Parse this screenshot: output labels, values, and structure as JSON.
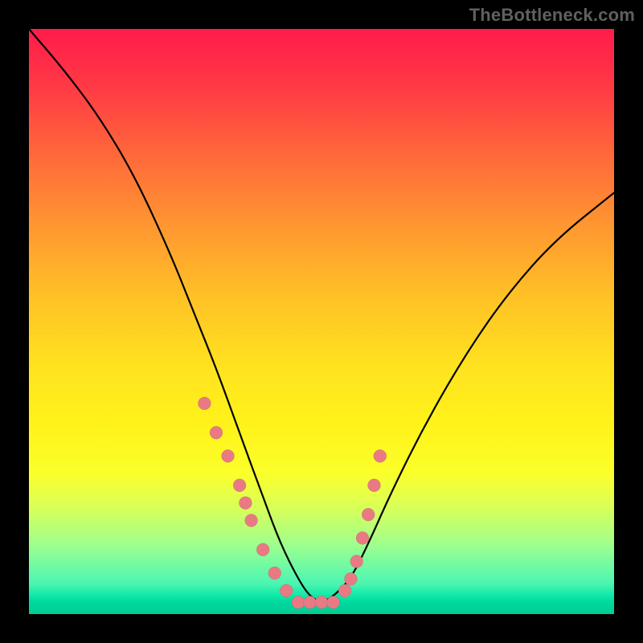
{
  "watermark": "TheBottleneck.com",
  "chart_data": {
    "type": "line",
    "title": "",
    "xlabel": "",
    "ylabel": "",
    "xlim": [
      0,
      100
    ],
    "ylim": [
      0,
      100
    ],
    "grid": false,
    "legend": false,
    "series": [
      {
        "name": "bottleneck-curve",
        "x": [
          0,
          6,
          12,
          18,
          24,
          28,
          32,
          36,
          40,
          43,
          46,
          48,
          50,
          52,
          55,
          58,
          62,
          68,
          75,
          82,
          90,
          100
        ],
        "y": [
          100,
          93,
          85,
          75,
          62,
          52,
          42,
          31,
          20,
          12,
          6,
          3,
          2,
          3,
          6,
          12,
          21,
          33,
          45,
          55,
          64,
          72
        ]
      }
    ],
    "markers": {
      "name": "bottleneck-data-points",
      "x": [
        30,
        32,
        34,
        36,
        37,
        38,
        40,
        42,
        44,
        46,
        48,
        50,
        52,
        54,
        55,
        56,
        57,
        58,
        59,
        60
      ],
      "y": [
        36,
        31,
        27,
        22,
        19,
        16,
        11,
        7,
        4,
        2,
        2,
        2,
        2,
        4,
        6,
        9,
        13,
        17,
        22,
        27
      ]
    },
    "gradient_stops": [
      {
        "pos": 0,
        "color": "#ff1b4a"
      },
      {
        "pos": 50,
        "color": "#ffe31f"
      },
      {
        "pos": 100,
        "color": "#00e6a8"
      }
    ]
  }
}
